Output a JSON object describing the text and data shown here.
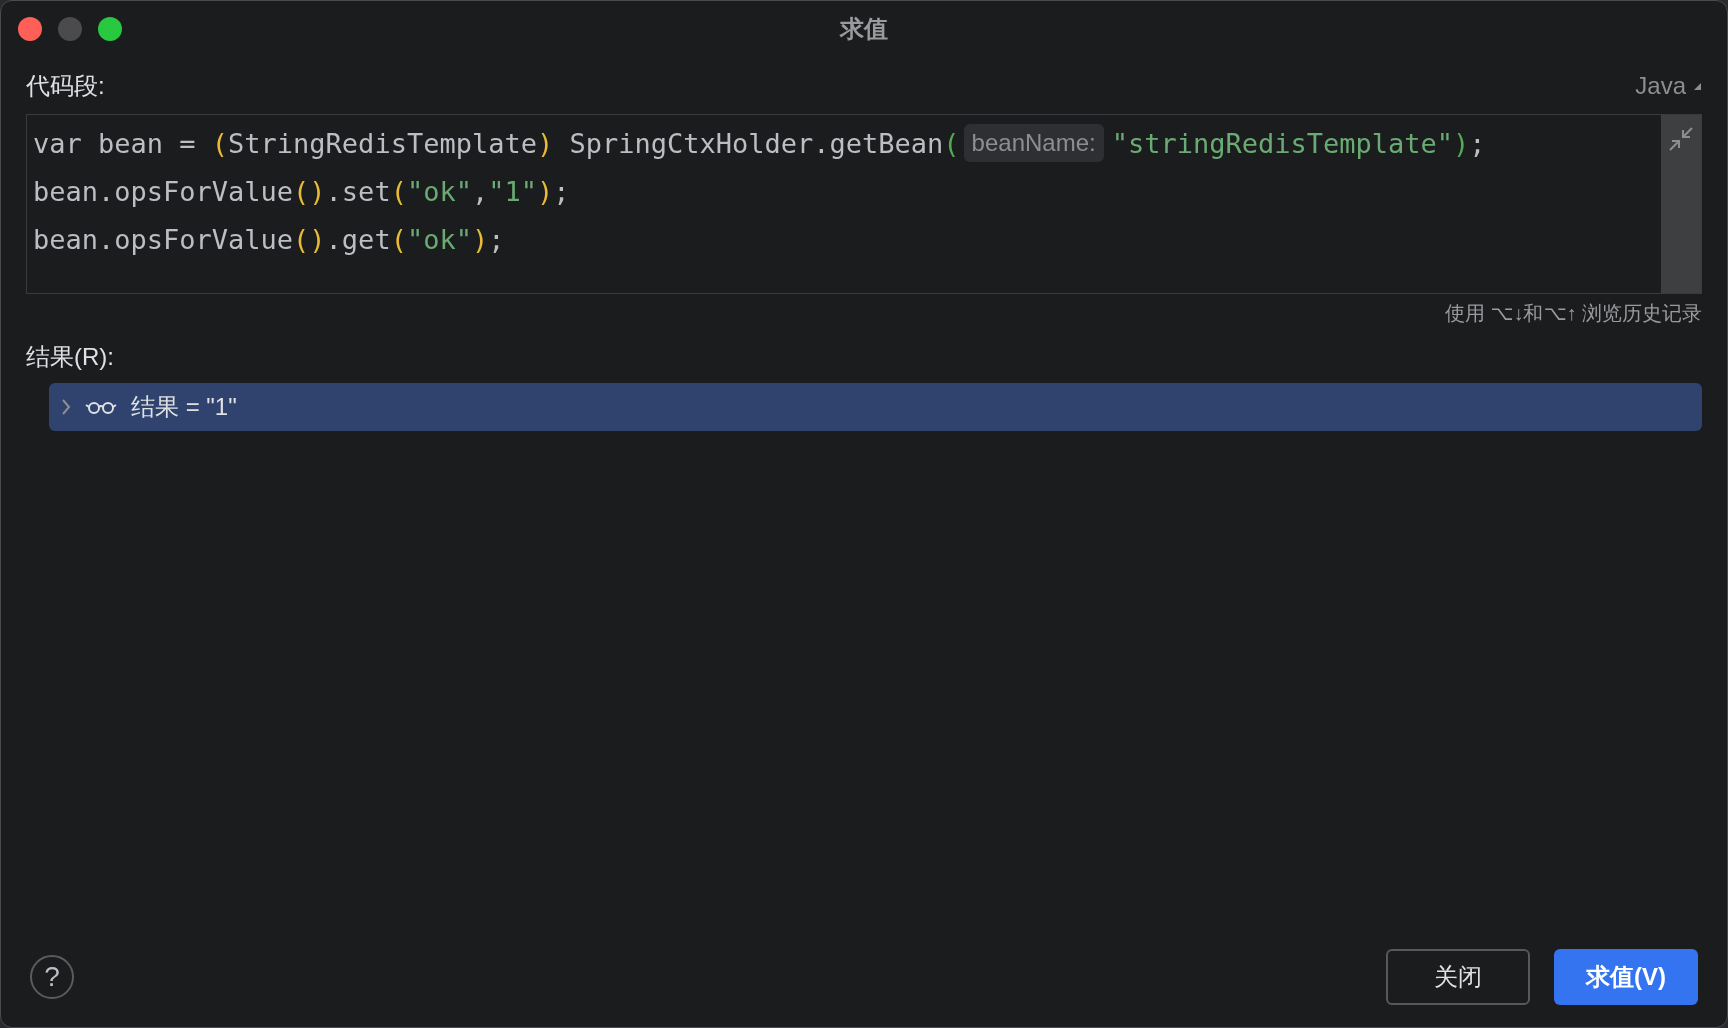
{
  "window": {
    "title": "求值"
  },
  "snippet": {
    "label": "代码段:",
    "language": "Java",
    "lines": [
      [
        {
          "kind": "plain",
          "text": "var bean = "
        },
        {
          "kind": "paren",
          "text": "("
        },
        {
          "kind": "plain",
          "text": "StringRedisTemplate"
        },
        {
          "kind": "paren",
          "text": ")"
        },
        {
          "kind": "plain",
          "text": " SpringCtxHolder.getBean"
        },
        {
          "kind": "call",
          "text": "("
        },
        {
          "kind": "hint",
          "text": "beanName:"
        },
        {
          "kind": "string",
          "text": "\"stringRedisTemplate\""
        },
        {
          "kind": "call",
          "text": ")"
        },
        {
          "kind": "plain",
          "text": ";"
        }
      ],
      [
        {
          "kind": "plain",
          "text": "bean.opsForValue"
        },
        {
          "kind": "paren",
          "text": "()"
        },
        {
          "kind": "plain",
          "text": ".set"
        },
        {
          "kind": "paren",
          "text": "("
        },
        {
          "kind": "string",
          "text": "\"ok\""
        },
        {
          "kind": "plain",
          "text": ","
        },
        {
          "kind": "string",
          "text": "\"1\""
        },
        {
          "kind": "paren",
          "text": ")"
        },
        {
          "kind": "plain",
          "text": ";"
        }
      ],
      [
        {
          "kind": "plain",
          "text": "bean.opsForValue"
        },
        {
          "kind": "paren",
          "text": "()"
        },
        {
          "kind": "plain",
          "text": ".get"
        },
        {
          "kind": "paren",
          "text": "("
        },
        {
          "kind": "string",
          "text": "\"ok\""
        },
        {
          "kind": "paren",
          "text": ")"
        },
        {
          "kind": "plain",
          "text": ";"
        }
      ]
    ],
    "history_hint": "使用 ⌥↓和⌥↑ 浏览历史记录"
  },
  "result": {
    "label": "结果(R):",
    "rows": [
      {
        "text": "结果 = \"1\"",
        "expanded": false,
        "selected": true
      }
    ]
  },
  "buttons": [
    {
      "label": "关闭",
      "kind": "secondary"
    },
    {
      "label": "求值(V)",
      "kind": "primary"
    }
  ],
  "help": "?"
}
